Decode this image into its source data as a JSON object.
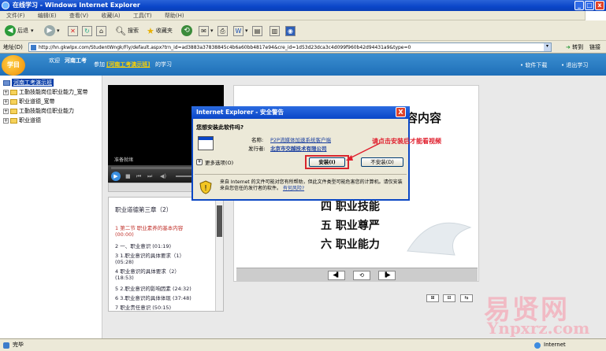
{
  "window": {
    "title": "在线学习 - Windows Internet Explorer"
  },
  "menu": [
    "文件(F)",
    "编辑(E)",
    "查看(V)",
    "收藏(A)",
    "工具(T)",
    "帮助(H)"
  ],
  "toolbar": {
    "back": "后退",
    "search": "搜索",
    "favorites": "收藏夹"
  },
  "address": {
    "label": "地址(D)",
    "url": "http://hn.gkwlpx.com/StudentWngk/Fly/default.aspx?trn_id=ad3883a37838845c4b6a60bb4817e94&cre_id=1d53d23dca3c4d099f960b42d94431a9&type=0",
    "go": "转到",
    "links": "链接"
  },
  "site": {
    "welcome": "欢迎",
    "user": "河南工考",
    "join_prefix": "参加",
    "course": "[河南工考演示班]",
    "join_suffix": "的学习",
    "logo": "学目",
    "download": "• 软件下载",
    "logout": "• 退出学习"
  },
  "tree": {
    "root": "河南工考演示班",
    "items": [
      "工勤技能岗位职业能力_宽带",
      "职业道德_宽带",
      "工勤技能岗位职业能力",
      "职业道德"
    ]
  },
  "player": {
    "status": "准备就绪"
  },
  "chapters": {
    "title": "职业道德第三章（2）",
    "items": [
      "1 第二节 职业素养的基本内容",
      "(00:00)",
      "2 一、职业意识 (01:19)",
      "3 1.职业意识的具体要求（1）",
      "(05:28)",
      "4 职业意识的具体要求（2）",
      "(18:53)",
      "5 2.职业意识的影响因素 (24:32)",
      "6 3.职业意识的具体体现 (37:48)",
      "7 职业责任意识 (50:15)"
    ]
  },
  "slide": {
    "heading_tail": "容内容",
    "line4": "四  职业技能",
    "line5": "五  职业尊严",
    "line6": "六  职业能力"
  },
  "dialog": {
    "title": "Internet Explorer - 安全警告",
    "question": "您想安装此软件吗?",
    "name_label": "名称:",
    "name_value": "P2P流媒体加速系统客户端",
    "publisher_label": "发行者:",
    "publisher_value": "北京市交越技术有限公司",
    "more_options": "更多选项(O)",
    "install": "安装(I)",
    "no_install": "不安装(D)",
    "warning": "来自 Internet 的文件可能对您有所帮助，但此文件类型可能危害您的计算机。请仅安装来自您信任的发行者的软件。",
    "risk_link": "有何风险?",
    "close": "X"
  },
  "annotation": "请点击安装后才能看视频",
  "status": {
    "left": "完毕",
    "right": "Internet"
  },
  "watermark": {
    "line1": "易贤网",
    "line2": "Ynpxrz.com"
  },
  "colors": {
    "accent": "#0a46c8",
    "annotation": "#e0202e",
    "course": "#ffd200"
  }
}
